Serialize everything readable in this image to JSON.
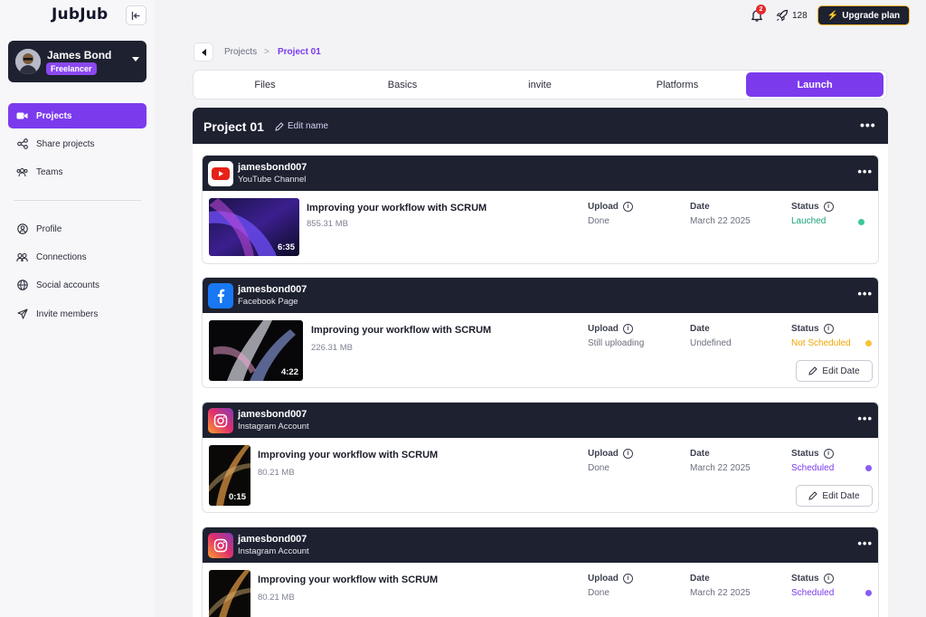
{
  "app": {
    "logo": "JubJub"
  },
  "profile": {
    "name": "James Bond",
    "role": "Freelancer"
  },
  "sidebar": {
    "items": [
      {
        "label": "Projects",
        "icon": "video-camera-icon",
        "active": true
      },
      {
        "label": "Share projects",
        "icon": "share-icon"
      },
      {
        "label": "Teams",
        "icon": "teams-icon"
      },
      {
        "label": "Profile",
        "icon": "user-circle-icon"
      },
      {
        "label": "Connections",
        "icon": "connections-icon"
      },
      {
        "label": "Social accounts",
        "icon": "globe-icon"
      },
      {
        "label": "Invite members",
        "icon": "send-icon"
      }
    ]
  },
  "topbar": {
    "notifications_count": "2",
    "credits": "128",
    "upgrade_label": "Upgrade plan"
  },
  "breadcrumb": {
    "parent": "Projects",
    "separator": ">",
    "current": "Project 01"
  },
  "tabs": [
    {
      "label": "Files"
    },
    {
      "label": "Basics"
    },
    {
      "label": "invite"
    },
    {
      "label": "Platforms"
    },
    {
      "label": "Launch",
      "active": true
    }
  ],
  "project": {
    "title": "Project 01",
    "edit_name_label": "Edit name",
    "menu_label": "•••"
  },
  "columns": {
    "upload": "Upload",
    "date": "Date",
    "status": "Status",
    "info_glyph": "i"
  },
  "edit_date_label": "Edit Date",
  "cards": [
    {
      "account": "jamesbond007",
      "type": "YouTube Channel",
      "platform": "youtube",
      "video_title": "Improving your workflow with SCRUM",
      "size": "855.31 MB",
      "duration": "6:35",
      "upload": "Done",
      "date": "March 22 2025",
      "status": "Lauched",
      "status_color": "#1aa37a",
      "dot_color": "#3cc79a"
    },
    {
      "account": "jamesbond007",
      "type": "Facebook Page",
      "platform": "facebook",
      "video_title": "Improving your workflow with SCRUM",
      "size": "226.31 MB",
      "duration": "4:22",
      "upload": "Still uploading",
      "date": "Undefined",
      "status": "Not Scheduled",
      "status_color": "#f0a500",
      "dot_color": "#f6c237"
    },
    {
      "account": "jamesbond007",
      "type": "Instagram Account",
      "platform": "instagram",
      "video_title": "Improving your workflow with SCRUM",
      "size": "80.21 MB",
      "duration": "0:15",
      "upload": "Done",
      "date": "March 22 2025",
      "status": "Scheduled",
      "status_color": "#7c3aed",
      "dot_color": "#8b5cf6"
    },
    {
      "account": "jamesbond007",
      "type": "Instagram Account",
      "platform": "instagram",
      "video_title": "Improving your workflow with SCRUM",
      "size": "80.21 MB",
      "duration": "",
      "upload": "Done",
      "date": "March 22 2025",
      "status": "Scheduled",
      "status_color": "#7c3aed",
      "dot_color": "#8b5cf6"
    }
  ]
}
